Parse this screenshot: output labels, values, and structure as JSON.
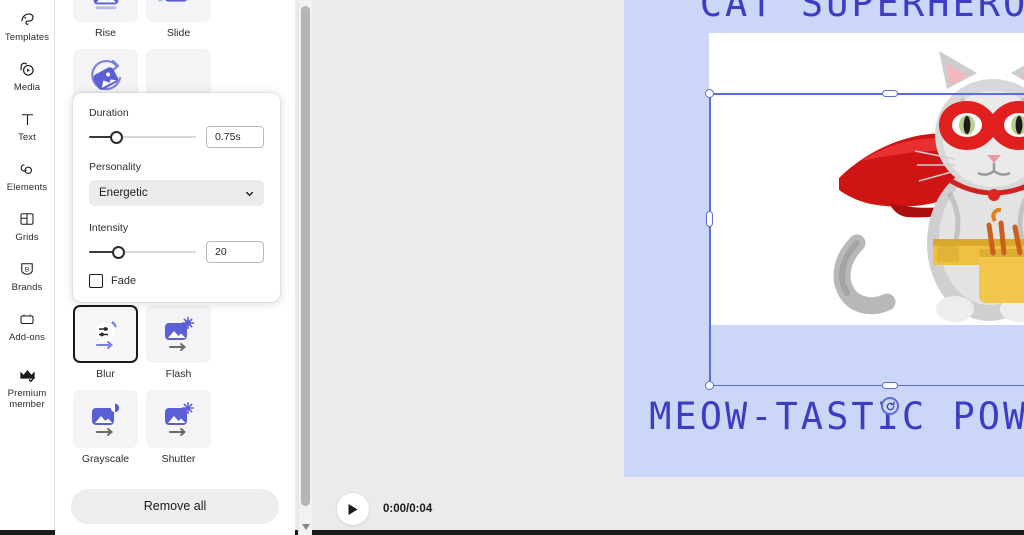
{
  "sidebar": {
    "items": [
      {
        "label": "Templates",
        "icon": "templates-icon"
      },
      {
        "label": "Media",
        "icon": "media-icon"
      },
      {
        "label": "Text",
        "icon": "text-icon"
      },
      {
        "label": "Elements",
        "icon": "elements-icon"
      },
      {
        "label": "Grids",
        "icon": "grids-icon"
      },
      {
        "label": "Brands",
        "icon": "brands-icon"
      },
      {
        "label": "Add-ons",
        "icon": "addons-icon"
      },
      {
        "label": "Premium member",
        "icon": "crown-icon"
      }
    ]
  },
  "animation_panel": {
    "top_tiles": [
      {
        "label": "Rise",
        "icon": "rise-animation-icon",
        "selected": false
      },
      {
        "label": "Slide",
        "icon": "slide-animation-icon",
        "selected": false
      },
      {
        "label": "Spin",
        "icon": "spin-animation-icon",
        "selected": false
      }
    ],
    "bottom_tiles": [
      {
        "label": "Blur",
        "icon": "blur-animation-icon",
        "selected": true
      },
      {
        "label": "Flash",
        "icon": "flash-animation-icon",
        "selected": false
      },
      {
        "label": "Grayscale",
        "icon": "grayscale-animation-icon",
        "selected": false
      },
      {
        "label": "Shutter",
        "icon": "shutter-animation-icon",
        "selected": false
      }
    ],
    "remove_all_label": "Remove all"
  },
  "settings_popup": {
    "duration": {
      "label": "Duration",
      "value": "0.75s",
      "slider_percent": 25
    },
    "personality": {
      "label": "Personality",
      "value": "Energetic"
    },
    "intensity": {
      "label": "Intensity",
      "value": "20",
      "slider_percent": 27
    },
    "fade": {
      "label": "Fade",
      "checked": false
    }
  },
  "player": {
    "time": "0:00/0:04",
    "play_icon": "play-icon"
  },
  "canvas": {
    "headline_top": "CAT SUPERHERO",
    "headline_bottom": "MEOW-TASTIC POWER",
    "background_color": "#ccd7f7",
    "text_color": "#3d3dc4",
    "selection_color": "#5a6fd8"
  }
}
